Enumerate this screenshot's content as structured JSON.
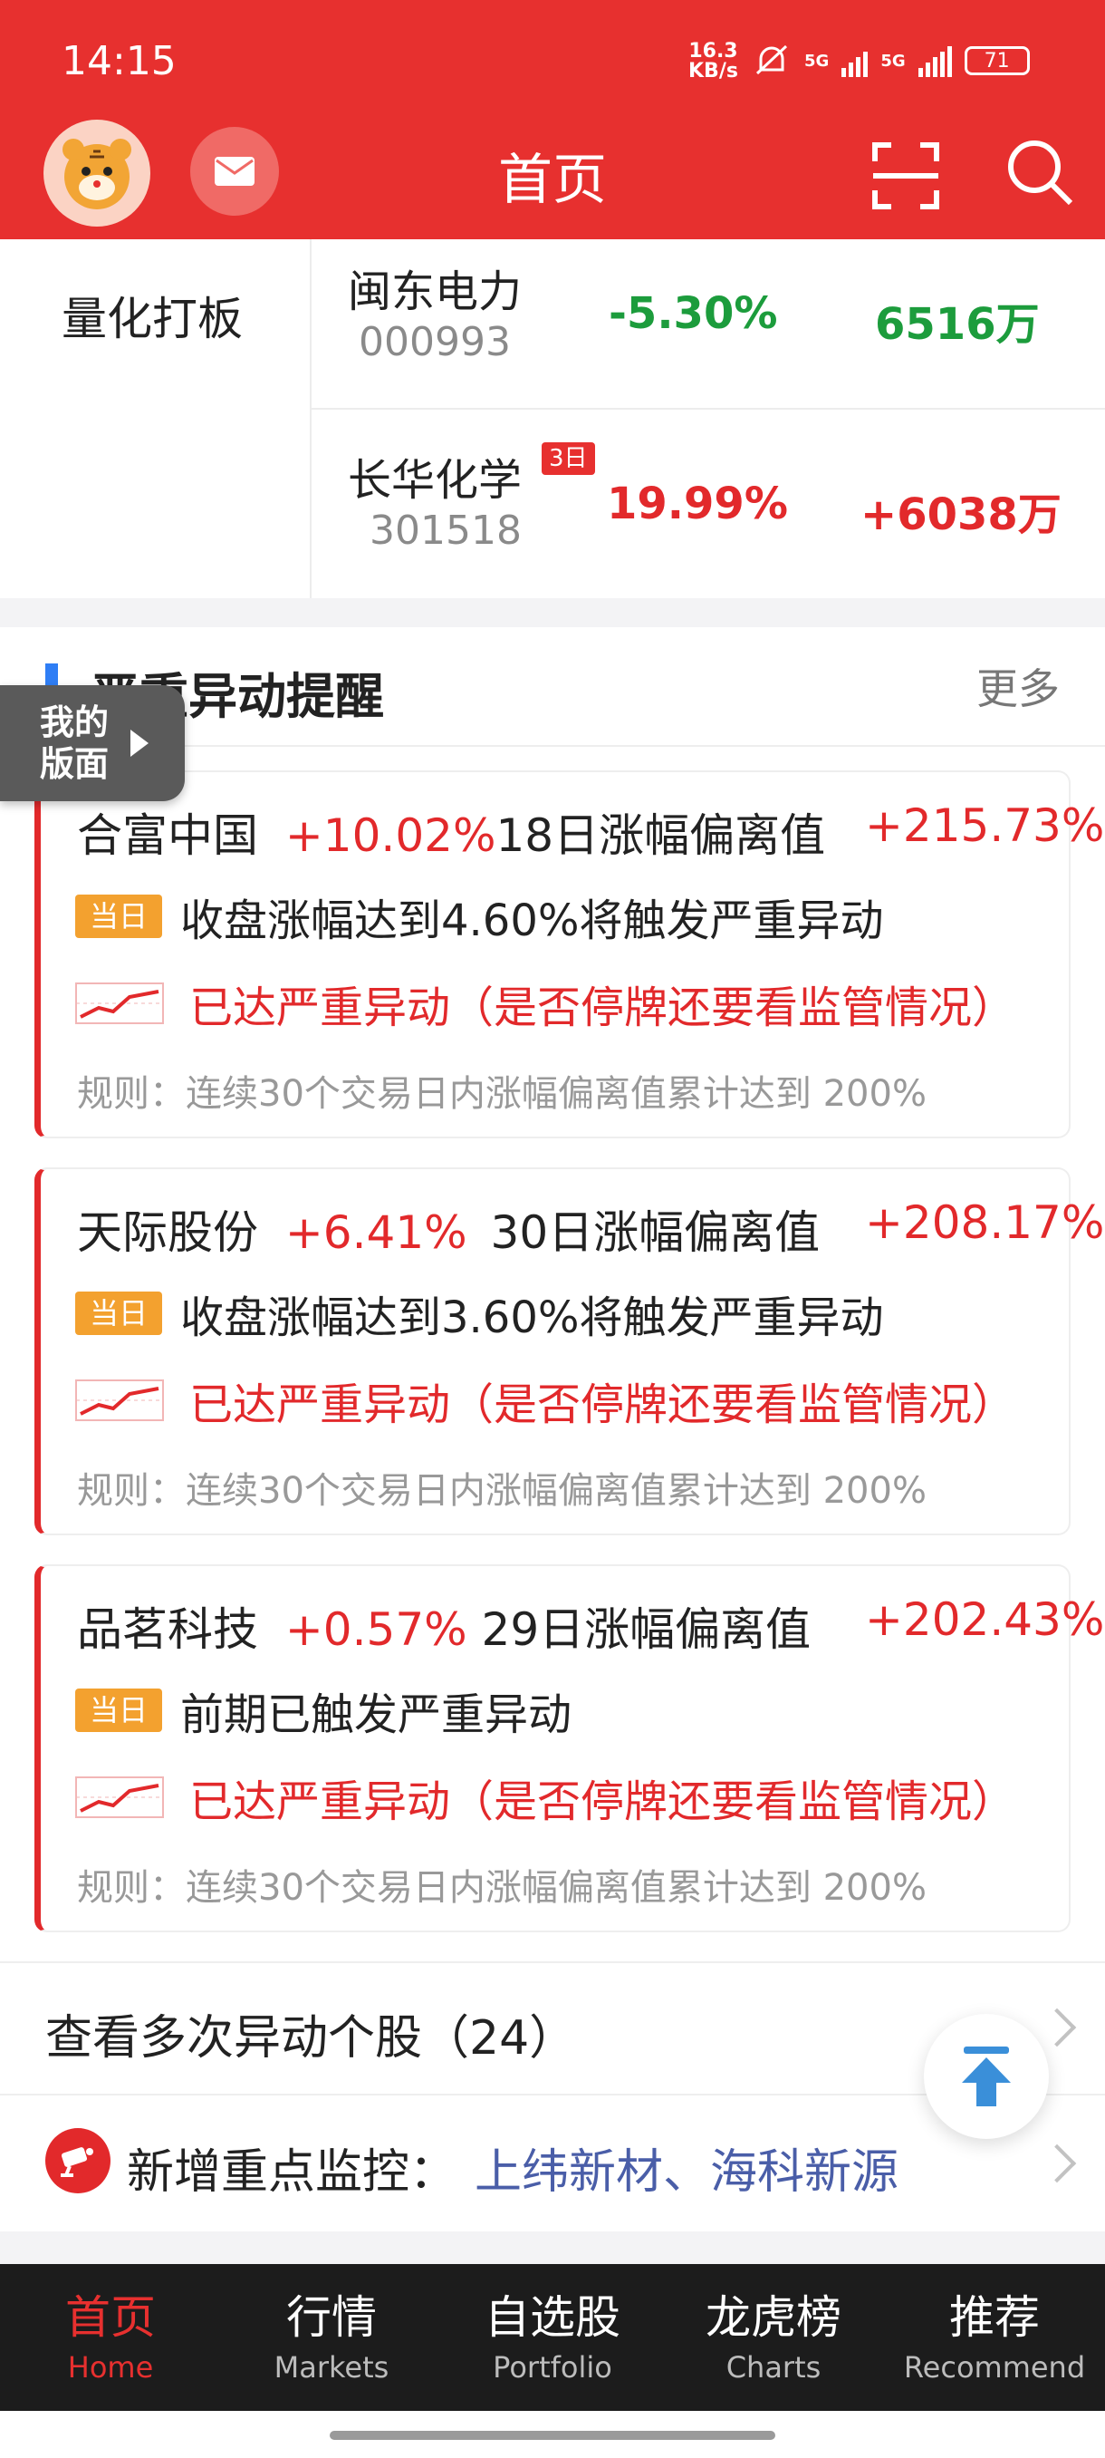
{
  "status_bar": {
    "time": "14:15",
    "speed_value": "16.3",
    "speed_unit": "KB/s",
    "net1": "5G",
    "net2": "5G",
    "battery": "71"
  },
  "header": {
    "title": "首页"
  },
  "quant": {
    "label": "量化打板",
    "stocks": [
      {
        "name": "闽东电力",
        "code": "000993",
        "pct": "-5.30%",
        "amount": "6516万",
        "tag": ""
      },
      {
        "name": "长华化学",
        "code": "301518",
        "pct": "19.99%",
        "amount": "+6038万",
        "tag": "3日"
      }
    ]
  },
  "alerts": {
    "title": "严重异动提醒",
    "more": "更多",
    "floating_tab": {
      "line1": "我的",
      "line2": "版面"
    },
    "items": [
      {
        "name": "合富中国",
        "change": "+10.02%",
        "period": "18日涨幅偏离值",
        "deviation": "+215.73%",
        "tag": "当日",
        "trigger": "收盘涨幅达到4.60%将触发严重异动",
        "status": "已达严重异动（是否停牌还要看监管情况）",
        "rule": "规则：连续30个交易日内涨幅偏离值累计达到 200%"
      },
      {
        "name": "天际股份",
        "change": "+6.41%",
        "period": "30日涨幅偏离值",
        "deviation": "+208.17%",
        "tag": "当日",
        "trigger": "收盘涨幅达到3.60%将触发严重异动",
        "status": "已达严重异动（是否停牌还要看监管情况）",
        "rule": "规则：连续30个交易日内涨幅偏离值累计达到 200%"
      },
      {
        "name": "品茗科技",
        "change": "+0.57%",
        "period": "29日涨幅偏离值",
        "deviation": "+202.43%",
        "tag": "当日",
        "trigger": "前期已触发严重异动",
        "status": "已达严重异动（是否停牌还要看监管情况）",
        "rule": "规则：连续30个交易日内涨幅偏离值累计达到 200%"
      }
    ]
  },
  "multi_row": {
    "label": "查看多次异动个股（24）"
  },
  "monitor_row": {
    "label": "新增重点监控：",
    "stocks": "上纬新材、海科新源"
  },
  "tabs": [
    {
      "zh": "首页",
      "en": "Home"
    },
    {
      "zh": "行情",
      "en": "Markets"
    },
    {
      "zh": "自选股",
      "en": "Portfolio"
    },
    {
      "zh": "龙虎榜",
      "en": "Charts"
    },
    {
      "zh": "推荐",
      "en": "Recommend"
    }
  ],
  "colors": {
    "brand_red": "#e7302f",
    "up_red": "#e2292b",
    "down_green": "#1c9c3c",
    "accent_blue": "#2f7ef5",
    "tag_orange": "#f3a12f"
  }
}
